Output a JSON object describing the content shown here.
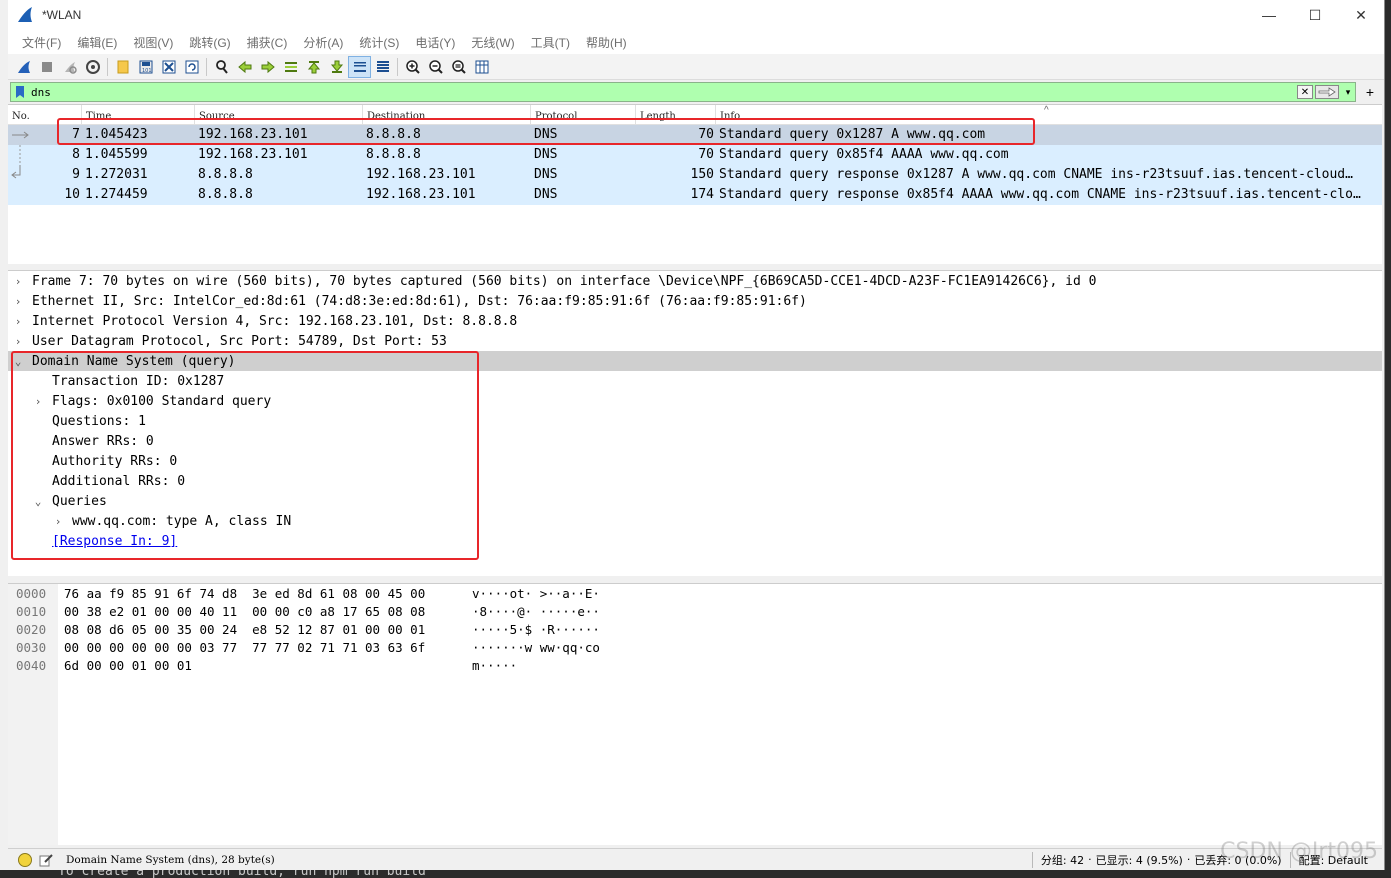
{
  "window": {
    "title": "*WLAN",
    "minimize": "—",
    "maximize": "☐",
    "close": "✕"
  },
  "menu": [
    "文件(F)",
    "编辑(E)",
    "视图(V)",
    "跳转(G)",
    "捕获(C)",
    "分析(A)",
    "统计(S)",
    "电话(Y)",
    "无线(W)",
    "工具(T)",
    "帮助(H)"
  ],
  "toolbar_icons": [
    "shark-fin-start-icon",
    "stop-icon",
    "restart-icon",
    "capture-options-icon",
    "open-file-icon",
    "save-file-icon",
    "close-file-icon",
    "reload-icon",
    "find-packet-icon",
    "go-back-icon",
    "go-forward-icon",
    "go-to-packet-icon",
    "first-packet-icon",
    "last-packet-icon",
    "auto-scroll-icon",
    "colorize-icon",
    "zoom-in-icon",
    "zoom-out-icon",
    "zoom-normal-icon",
    "resize-columns-icon"
  ],
  "filter": {
    "value": "dns"
  },
  "packet_list": {
    "columns": [
      "No.",
      "Time",
      "Source",
      "Destination",
      "Protocol",
      "Length",
      "Info"
    ],
    "rows": [
      {
        "no": "7",
        "time": "1.045423",
        "source": "192.168.23.101",
        "destination": "8.8.8.8",
        "protocol": "DNS",
        "length": "70",
        "info": "Standard query 0x1287 A www.qq.com"
      },
      {
        "no": "8",
        "time": "1.045599",
        "source": "192.168.23.101",
        "destination": "8.8.8.8",
        "protocol": "DNS",
        "length": "70",
        "info": "Standard query 0x85f4 AAAA www.qq.com"
      },
      {
        "no": "9",
        "time": "1.272031",
        "source": "8.8.8.8",
        "destination": "192.168.23.101",
        "protocol": "DNS",
        "length": "150",
        "info": "Standard query response 0x1287 A www.qq.com CNAME ins-r23tsuuf.ias.tencent-cloud…"
      },
      {
        "no": "10",
        "time": "1.274459",
        "source": "8.8.8.8",
        "destination": "192.168.23.101",
        "protocol": "DNS",
        "length": "174",
        "info": "Standard query response 0x85f4 AAAA www.qq.com CNAME ins-r23tsuuf.ias.tencent-clo…"
      }
    ]
  },
  "details": [
    {
      "text": "Frame 7: 70 bytes on wire (560 bits), 70 bytes captured (560 bits) on interface \\Device\\NPF_{6B69CA5D-CCE1-4DCD-A23F-FC1EA91426C6}, id 0",
      "level": 0,
      "chevron": "›"
    },
    {
      "text": "Ethernet II, Src: IntelCor_ed:8d:61 (74:d8:3e:ed:8d:61), Dst: 76:aa:f9:85:91:6f (76:aa:f9:85:91:6f)",
      "level": 0,
      "chevron": "›"
    },
    {
      "text": "Internet Protocol Version 4, Src: 192.168.23.101, Dst: 8.8.8.8",
      "level": 0,
      "chevron": "›"
    },
    {
      "text": "User Datagram Protocol, Src Port: 54789, Dst Port: 53",
      "level": 0,
      "chevron": "›"
    },
    {
      "text": "Domain Name System (query)",
      "level": 0,
      "chevron": "⌄",
      "selected": true
    },
    {
      "text": "Transaction ID: 0x1287",
      "level": 1,
      "chevron": ""
    },
    {
      "text": "Flags: 0x0100 Standard query",
      "level": 1,
      "chevron": "›"
    },
    {
      "text": "Questions: 1",
      "level": 1,
      "chevron": ""
    },
    {
      "text": "Answer RRs: 0",
      "level": 1,
      "chevron": ""
    },
    {
      "text": "Authority RRs: 0",
      "level": 1,
      "chevron": ""
    },
    {
      "text": "Additional RRs: 0",
      "level": 1,
      "chevron": ""
    },
    {
      "text": "Queries",
      "level": 1,
      "chevron": "⌄"
    },
    {
      "text": "www.qq.com: type A, class IN",
      "level": 2,
      "chevron": "›"
    },
    {
      "text": "[Response In: 9]",
      "level": 1,
      "chevron": "",
      "link": true
    }
  ],
  "bytes": [
    {
      "offset": "0000",
      "hex_plain": "76 aa f9 85 91 6f 74 d8  3e ed 8d 61 08 00 45 00",
      "ascii": "v····ot· >··a··E·"
    },
    {
      "offset": "0010",
      "hex_plain": "00 38 e2 01 00 00 40 11  00 00 c0 a8 17 65 08 08",
      "ascii": "·8····@· ·····e··"
    },
    {
      "offset": "0020",
      "hex_plain": "08 08 d6 05 00 35 00 24  e8 52 12 87 01 00 00 01",
      "ascii": "·····5·$ ·R······"
    },
    {
      "offset": "0030",
      "hex_plain": "00 00 00 00 00 00 03 77  77 77 02 71 71 03 63 6f",
      "ascii": "·······w ww·qq·co"
    },
    {
      "offset": "0040",
      "hex_plain": "6d 00 00 01 00 01",
      "ascii": "m·····"
    }
  ],
  "status": {
    "text": "Domain Name System (dns), 28 byte(s)",
    "packets": "分组: 42",
    "displayed": "已显示: 4 (9.5%)",
    "dropped": "已丢弃: 0 (0.0%)",
    "profile": "配置: Default"
  },
  "watermark": "CSDN @Irt095",
  "terminal_text": "To create a production build, run npm run build"
}
